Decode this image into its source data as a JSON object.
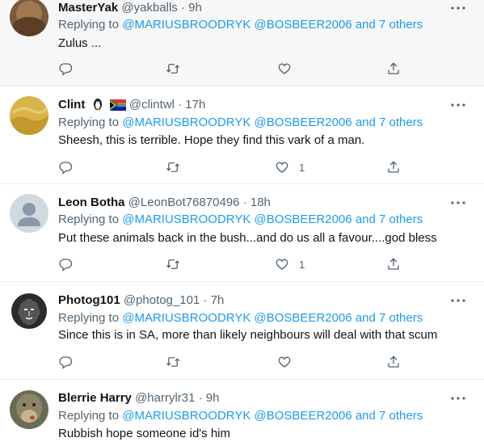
{
  "tweets": [
    {
      "name": "MasterYak",
      "handle": "@yakballs",
      "sep": "·",
      "time": "9h",
      "reply_prefix": "Replying to ",
      "mentions": "@MARIUSBROODRYK @BOSBEER2006 and 7 others",
      "text": "Zulus ...",
      "like_count": ""
    },
    {
      "name": "Clint",
      "handle": "@clintwl",
      "sep": "·",
      "time": "17h",
      "reply_prefix": "Replying to ",
      "mentions": "@MARIUSBROODRYK @BOSBEER2006 and 7 others",
      "text": "Sheesh, this is terrible. Hope they find this vark of a man.",
      "like_count": "1"
    },
    {
      "name": "Leon Botha",
      "handle": "@LeonBot76870496",
      "sep": "·",
      "time": "18h",
      "reply_prefix": "Replying to ",
      "mentions": "@MARIUSBROODRYK @BOSBEER2006 and 7 others",
      "text": "Put these animals back in the bush...and do us all a favour....god bless",
      "like_count": "1"
    },
    {
      "name": "Photog101",
      "handle": "@photog_101",
      "sep": "·",
      "time": "7h",
      "reply_prefix": "Replying to ",
      "mentions": "@MARIUSBROODRYK @BOSBEER2006 and 7 others",
      "text": "Since this is in SA, more than likely neighbours will deal with that scum",
      "like_count": ""
    },
    {
      "name": "Blerrie Harry",
      "handle": "@harrylr31",
      "sep": "·",
      "time": "9h",
      "reply_prefix": "Replying to ",
      "mentions": "@MARIUSBROODRYK @BOSBEER2006 and 7 others",
      "text": "Rubbish hope someone id's him",
      "like_count": ""
    }
  ],
  "colors": {
    "link": "#1d9bf0",
    "muted": "#536471",
    "text": "#0f1419",
    "divider": "#e6ecf0",
    "hover_bg": "#f7f7f7"
  },
  "icons": [
    "reply-icon",
    "retweet-icon",
    "like-icon",
    "share-icon",
    "more-icon",
    "penguin-emoji-icon",
    "south-africa-flag-icon"
  ]
}
